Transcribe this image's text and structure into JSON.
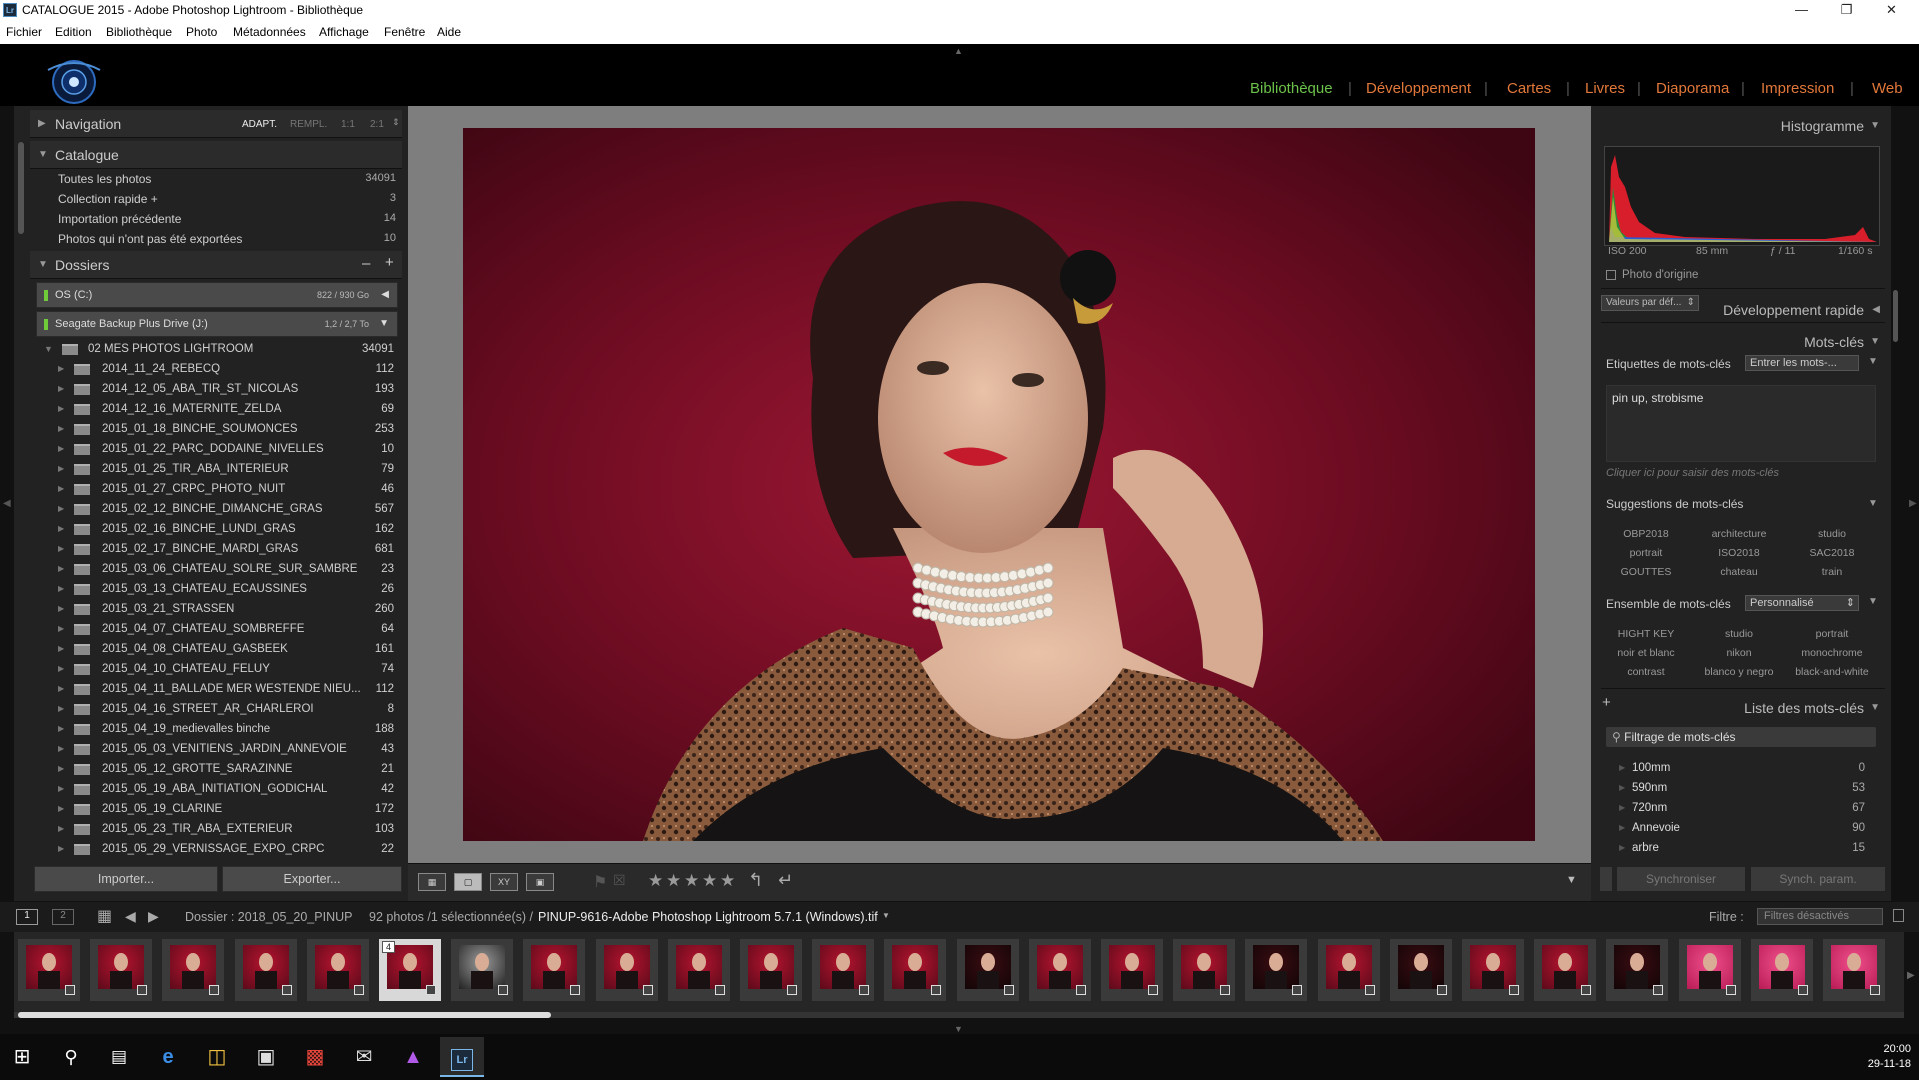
{
  "window": {
    "title": "CATALOGUE 2015 - Adobe Photoshop Lightroom - Bibliothèque",
    "app_icon": "Lr",
    "controls": [
      "minimize-icon",
      "maximize-icon",
      "close-icon"
    ]
  },
  "menu": [
    "Fichier",
    "Edition",
    "Bibliothèque",
    "Photo",
    "Métadonnées",
    "Affichage",
    "Fenêtre",
    "Aide"
  ],
  "modules": [
    "Bibliothèque",
    "Développement",
    "Cartes",
    "Livres",
    "Diaporama",
    "Impression",
    "Web"
  ],
  "colors": {
    "accent": "#e2783a",
    "active_module": "#6cc24a",
    "panel_bg": "#222222",
    "center_bg": "#7e7e7e"
  },
  "left": {
    "navigation": {
      "title": "Navigation",
      "zoom": [
        "ADAPT.",
        "REMPL.",
        "1:1",
        "2:1"
      ]
    },
    "catalog": {
      "title": "Catalogue",
      "items": [
        {
          "label": "Toutes les photos",
          "count": "34091"
        },
        {
          "label": "Collection rapide +",
          "count": "3"
        },
        {
          "label": "Importation précédente",
          "count": "14"
        },
        {
          "label": "Photos qui n'ont pas été exportées",
          "count": "10"
        }
      ]
    },
    "folders": {
      "title": "Dossiers",
      "minus": "–",
      "plus": "+",
      "volumes": [
        {
          "name": "OS (C:)",
          "size": "822 / 930 Go"
        },
        {
          "name": "Seagate Backup Plus Drive (J:)",
          "size": "1,2 / 2,7 To"
        }
      ],
      "root": {
        "name": "02 MES PHOTOS LIGHTROOM",
        "count": "34091"
      },
      "items": [
        {
          "name": "2014_11_24_REBECQ",
          "count": "112"
        },
        {
          "name": "2014_12_05_ABA_TIR_ST_NICOLAS",
          "count": "193"
        },
        {
          "name": "2014_12_16_MATERNITE_ZELDA",
          "count": "69"
        },
        {
          "name": "2015_01_18_BINCHE_SOUMONCES",
          "count": "253"
        },
        {
          "name": "2015_01_22_PARC_DODAINE_NIVELLES",
          "count": "10"
        },
        {
          "name": "2015_01_25_TIR_ABA_INTERIEUR",
          "count": "79"
        },
        {
          "name": "2015_01_27_CRPC_PHOTO_NUIT",
          "count": "46"
        },
        {
          "name": "2015_02_12_BINCHE_DIMANCHE_GRAS",
          "count": "567"
        },
        {
          "name": "2015_02_16_BINCHE_LUNDI_GRAS",
          "count": "162"
        },
        {
          "name": "2015_02_17_BINCHE_MARDI_GRAS",
          "count": "681"
        },
        {
          "name": "2015_03_06_CHATEAU_SOLRE_SUR_SAMBRE",
          "count": "23"
        },
        {
          "name": "2015_03_13_CHATEAU_ECAUSSINES",
          "count": "26"
        },
        {
          "name": "2015_03_21_STRASSEN",
          "count": "260"
        },
        {
          "name": "2015_04_07_CHATEAU_SOMBREFFE",
          "count": "64"
        },
        {
          "name": "2015_04_08_CHATEAU_GASBEEK",
          "count": "161"
        },
        {
          "name": "2015_04_10_CHATEAU_FELUY",
          "count": "74"
        },
        {
          "name": "2015_04_11_BALLADE MER WESTENDE NIEU...",
          "count": "112"
        },
        {
          "name": "2015_04_16_STREET_AR_CHARLEROI",
          "count": "8"
        },
        {
          "name": "2015_04_19_medievalles binche",
          "count": "188"
        },
        {
          "name": "2015_05_03_VENITIENS_JARDIN_ANNEVOIE",
          "count": "43"
        },
        {
          "name": "2015_05_12_GROTTE_SARAZINNE",
          "count": "21"
        },
        {
          "name": "2015_05_19_ABA_INITIATION_GODICHAL",
          "count": "42"
        },
        {
          "name": "2015_05_19_CLARINE",
          "count": "172"
        },
        {
          "name": "2015_05_23_TIR_ABA_EXTERIEUR",
          "count": "103"
        },
        {
          "name": "2015_05_29_VERNISSAGE_EXPO_CRPC",
          "count": "22"
        }
      ]
    },
    "import_btn": "Importer...",
    "export_btn": "Exporter..."
  },
  "right": {
    "histogram": {
      "title": "Histogramme",
      "iso": "ISO 200",
      "focal": "85 mm",
      "aperture": "ƒ / 11",
      "shutter": "1/160 s",
      "original": "Photo d'origine"
    },
    "quick_dev": {
      "preset": "Valeurs par déf...",
      "title": "Développement rapide"
    },
    "keywords": {
      "title": "Mots-clés",
      "tags_label": "Etiquettes de mots-clés",
      "tags_mode": "Entrer les mots-...",
      "tags_value": "pin up, strobisme",
      "tags_hint": "Cliquer ici pour saisir des mots-clés",
      "suggestions_title": "Suggestions de mots-clés",
      "suggestions": [
        "OBP2018",
        "architecture",
        "studio",
        "portrait",
        "ISO2018",
        "SAC2018",
        "GOUTTES",
        "chateau",
        "train"
      ],
      "set_label": "Ensemble de mots-clés",
      "set_value": "Personnalisé",
      "set": [
        "HIGHT KEY",
        "studio",
        "portrait",
        "noir et blanc",
        "nikon",
        "monochrome",
        "contrast",
        "blanco y negro",
        "black-and-white"
      ]
    },
    "keyword_list": {
      "title": "Liste des mots-clés",
      "plus": "+",
      "filter": "Filtrage de mots-clés",
      "items": [
        {
          "label": "100mm",
          "count": "0"
        },
        {
          "label": "590nm",
          "count": "53"
        },
        {
          "label": "720nm",
          "count": "67"
        },
        {
          "label": "Annevoie",
          "count": "90"
        },
        {
          "label": "arbre",
          "count": "15"
        }
      ]
    },
    "sync_btn": "Synchroniser",
    "sync_settings_btn": "Synch. param."
  },
  "filmbar": {
    "screen1": "1",
    "screen2": "2",
    "folder_label": "Dossier : 2018_05_20_PINUP",
    "count_label": "92 photos /1 sélectionnée(s) /",
    "file": "PINUP-9616-Adobe Photoshop Lightroom 5.7.1 (Windows).tif",
    "filter_label": "Filtre :",
    "filter_value": "Filtres désactivés"
  },
  "filmstrip": {
    "selected_index": 5,
    "selected_number": "4",
    "thumbs": [
      "red",
      "red",
      "red",
      "red",
      "red",
      "red",
      "gray",
      "red",
      "red",
      "red",
      "red",
      "red",
      "red",
      "dark",
      "red",
      "red",
      "red",
      "dark",
      "red",
      "dark",
      "red",
      "red",
      "dark",
      "pink",
      "pink",
      "pink"
    ]
  },
  "taskbar": {
    "icons": [
      "windows-start-icon",
      "search-icon",
      "task-view-icon",
      "edge-icon",
      "folder-icon",
      "store-icon",
      "gift-icon",
      "mail-icon",
      "triangle-app-icon",
      "lightroom-icon"
    ],
    "time": "20:00",
    "date": "29-11-18"
  }
}
